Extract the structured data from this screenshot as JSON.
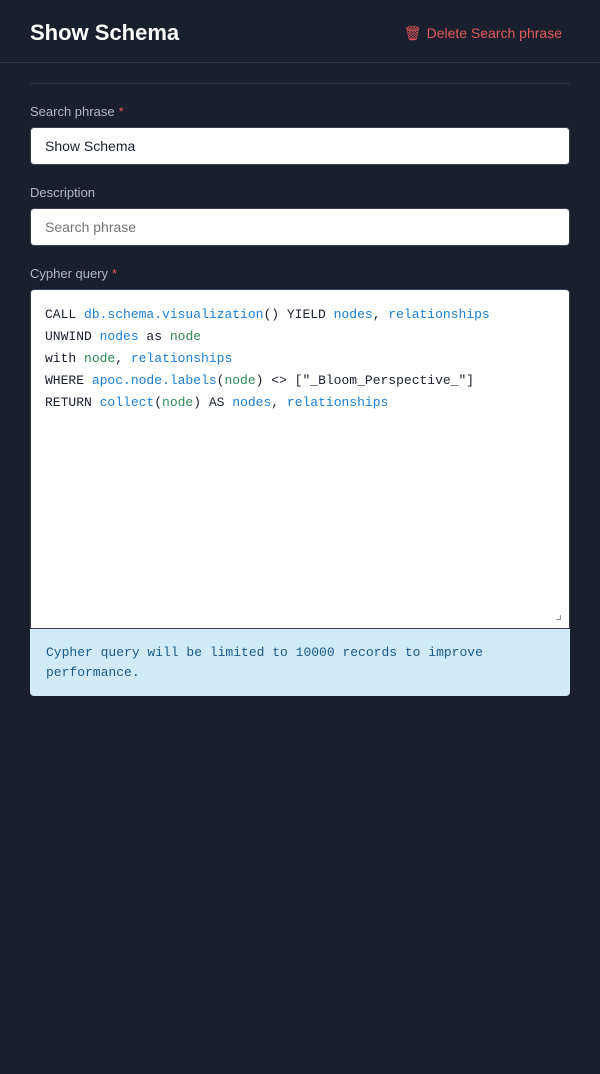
{
  "header": {
    "title": "Show Schema",
    "delete_label": "Delete Search phrase"
  },
  "form": {
    "search_phrase_label": "Search phrase",
    "search_phrase_value": "Show Schema",
    "description_label": "Description",
    "description_placeholder": "Search phrase",
    "cypher_query_label": "Cypher query",
    "cypher_query_lines": [
      {
        "parts": [
          {
            "text": "CALL ",
            "color": "plain"
          },
          {
            "text": "db.schema.visualization",
            "color": "blue"
          },
          {
            "text": "() YIELD ",
            "color": "plain"
          },
          {
            "text": "nodes",
            "color": "blue"
          },
          {
            "text": ", ",
            "color": "plain"
          },
          {
            "text": "relationships",
            "color": "blue"
          }
        ]
      },
      {
        "parts": [
          {
            "text": "UNWIND ",
            "color": "plain"
          },
          {
            "text": "nodes",
            "color": "blue"
          },
          {
            "text": " as ",
            "color": "plain"
          },
          {
            "text": "node",
            "color": "green"
          }
        ]
      },
      {
        "parts": [
          {
            "text": "with ",
            "color": "plain"
          },
          {
            "text": "node",
            "color": "green"
          },
          {
            "text": ", ",
            "color": "plain"
          },
          {
            "text": "relationships",
            "color": "blue"
          }
        ]
      },
      {
        "parts": [
          {
            "text": "WHERE ",
            "color": "plain"
          },
          {
            "text": "apoc.node.labels",
            "color": "blue"
          },
          {
            "text": "(",
            "color": "plain"
          },
          {
            "text": "node",
            "color": "green"
          },
          {
            "text": ") <> [\"_Bloom_Perspective_\"]",
            "color": "plain"
          }
        ]
      },
      {
        "parts": [
          {
            "text": "RETURN ",
            "color": "plain"
          },
          {
            "text": "collect",
            "color": "blue"
          },
          {
            "text": "(",
            "color": "plain"
          },
          {
            "text": "node",
            "color": "green"
          },
          {
            "text": ") AS ",
            "color": "plain"
          },
          {
            "text": "nodes",
            "color": "blue"
          },
          {
            "text": ", ",
            "color": "plain"
          },
          {
            "text": "relationships",
            "color": "blue"
          }
        ]
      }
    ],
    "info_message": "Cypher query will be limited to 10000 records to improve performance."
  },
  "icons": {
    "trash": "🗑"
  }
}
